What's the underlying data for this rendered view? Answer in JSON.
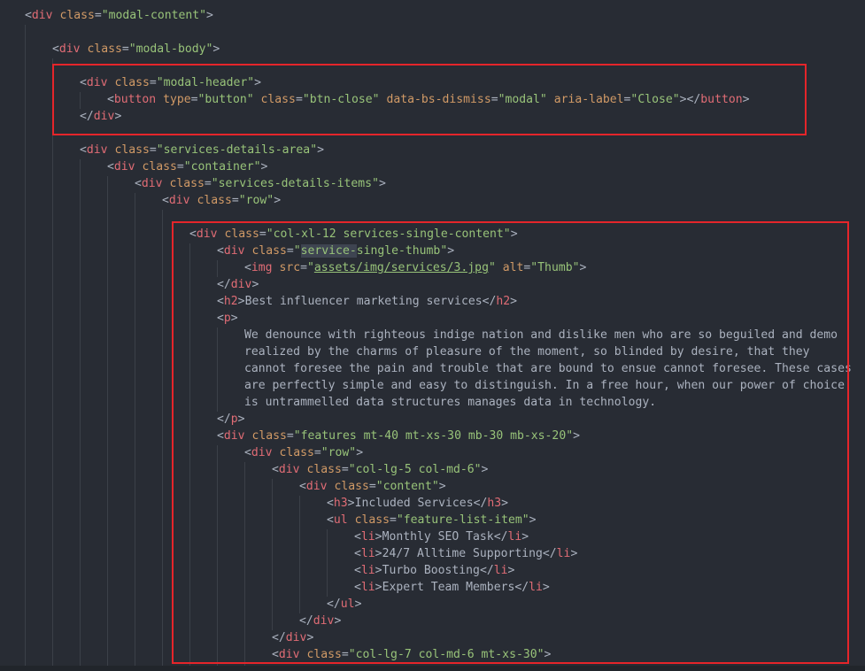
{
  "editor": {
    "theme": "dark",
    "colors": {
      "background": "#282c34",
      "tag": "#e06c75",
      "attribute": "#d19a66",
      "string": "#98c379",
      "text": "#abb2bf",
      "highlight_box": "#e5252a"
    }
  },
  "code": {
    "l0": "<div class=\"modal-content\">",
    "l1": "<div class=\"modal-body\">",
    "l2": "<div class=\"modal-header\">",
    "l3": "<button type=\"button\" class=\"btn-close\" data-bs-dismiss=\"modal\" aria-label=\"Close\"></button>",
    "l4": "</div>",
    "l5": "<div class=\"services-details-area\">",
    "l6": "<div class=\"container\">",
    "l7": "<div class=\"services-details-items\">",
    "l8": "<div class=\"row\">",
    "l9": "<div class=\"col-xl-12 services-single-content\">",
    "l10": "<div class=\"service-single-thumb\">",
    "l11": "<img src=\"assets/img/services/3.jpg\" alt=\"Thumb\">",
    "l12": "</div>",
    "l13": "<h2>Best influencer marketing services</h2>",
    "l14": "<p>",
    "l15": "We denounce with righteous indige nation and dislike men who are so beguiled and demo",
    "l16": "realized by the charms of pleasure of the moment, so blinded by desire, that they",
    "l17": "cannot foresee the pain and trouble that are bound to ensue cannot foresee. These cases",
    "l18": "are perfectly simple and easy to distinguish. In a free hour, when our power of choice",
    "l19": "is untrammelled data structures manages data in technology.",
    "l20": "</p>",
    "l21": "<div class=\"features mt-40 mt-xs-30 mb-30 mb-xs-20\">",
    "l22": "<div class=\"row\">",
    "l23": "<div class=\"col-lg-5 col-md-6\">",
    "l24": "<div class=\"content\">",
    "l25": "<h3>Included Services</h3>",
    "l26": "<ul class=\"feature-list-item\">",
    "l27": "<li>Monthly SEO Task</li>",
    "l28": "<li>24/7 Alltime Supporting</li>",
    "l29": "<li>Turbo Boosting</li>",
    "l30": "<li>Expert Team Members</li>",
    "l31": "</ul>",
    "l32": "</div>",
    "l33": "</div>",
    "l34": "<div class=\"col-lg-7 col-md-6 mt-xs-30\">"
  }
}
